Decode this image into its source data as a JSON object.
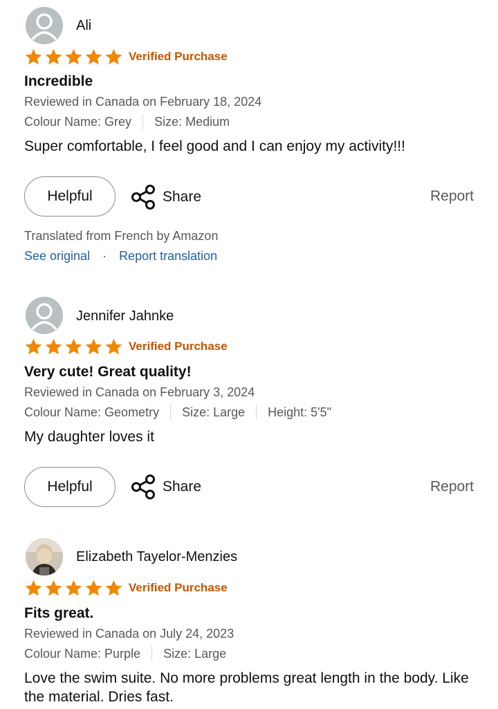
{
  "common": {
    "verified_label": "Verified Purchase",
    "helpful_label": "Helpful",
    "share_label": "Share",
    "report_label": "Report",
    "star_color": "#f08804",
    "verified_color": "#c45500",
    "link_color": "#2162a1",
    "rating_stars": 5
  },
  "reviews": [
    {
      "name": "Ali",
      "avatar": "default-avatar-icon",
      "title": "Incredible",
      "date": "Reviewed in Canada on February 18, 2024",
      "attributes": [
        "Colour Name: Grey",
        "Size: Medium"
      ],
      "body": "Super comfortable, I feel good and I can enjoy my activity!!!",
      "translation": {
        "note": "Translated from French by Amazon",
        "see_original": "See original",
        "separator": "·",
        "report_translation": "Report translation"
      }
    },
    {
      "name": "Jennifer Jahnke",
      "avatar": "default-avatar-icon",
      "title": "Very cute! Great quality!",
      "date": "Reviewed in Canada on February 3, 2024",
      "attributes": [
        "Colour Name: Geometry",
        "Size: Large",
        "Height: 5'5\""
      ],
      "body": "My daughter loves it"
    },
    {
      "name": "Elizabeth Tayelor-Menzies",
      "avatar": "user-photo",
      "title": "Fits great.",
      "date": "Reviewed in Canada on July 24, 2023",
      "attributes": [
        "Colour Name: Purple",
        "Size: Large"
      ],
      "body": "Love the swim suite. No more problems great length in the body. Like the material. Dries fast."
    }
  ]
}
